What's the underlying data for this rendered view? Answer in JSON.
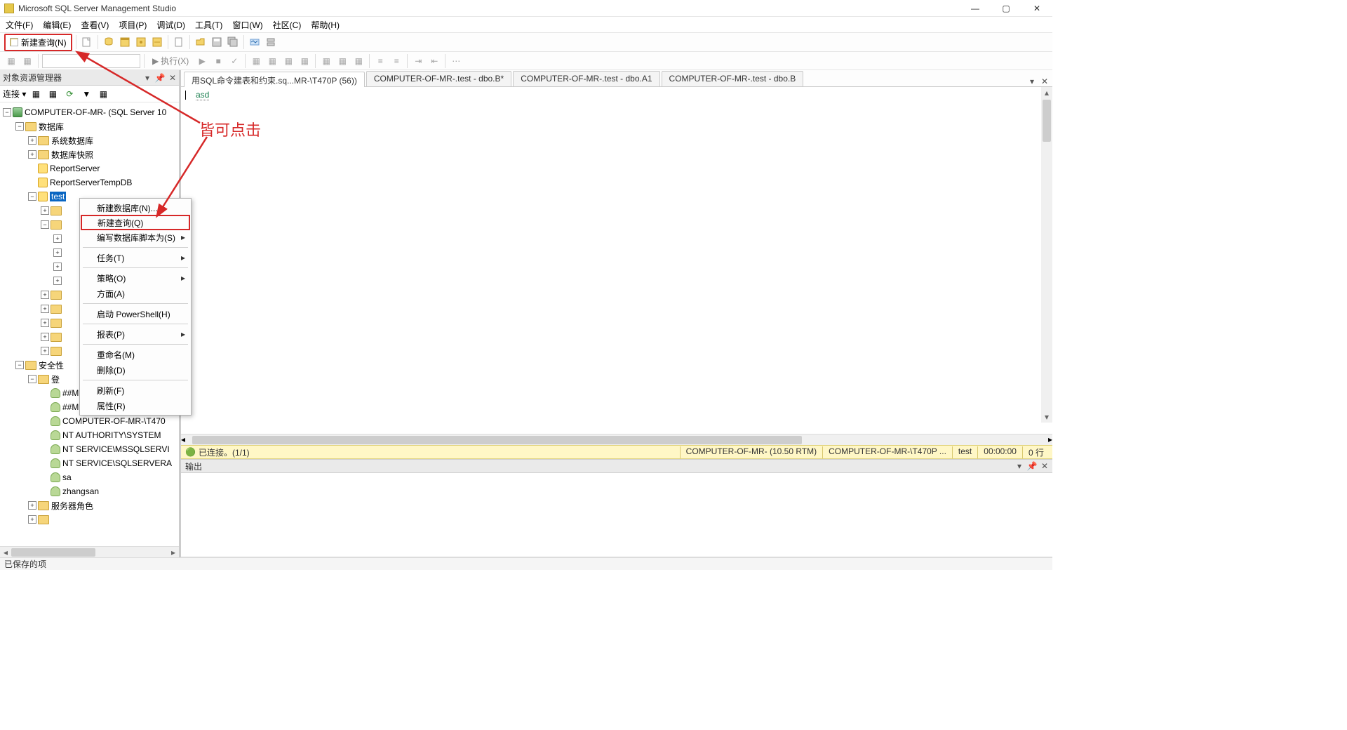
{
  "window": {
    "title": "Microsoft SQL Server Management Studio"
  },
  "menu": {
    "file": "文件(F)",
    "edit": "编辑(E)",
    "view": "查看(V)",
    "project": "项目(P)",
    "debug": "调试(D)",
    "tools": "工具(T)",
    "window": "窗口(W)",
    "community": "社区(C)",
    "help": "帮助(H)"
  },
  "toolbar": {
    "new_query": "新建查询(N)",
    "execute": "执行(X)"
  },
  "object_explorer": {
    "title": "对象资源管理器",
    "connect_label": "连接 ▾",
    "server": "COMPUTER-OF-MR- (SQL Server 10",
    "db_root": "数据库",
    "sys_db": "系统数据库",
    "db_snapshot": "数据库快照",
    "report_server": "ReportServer",
    "report_server_temp": "ReportServerTempDB",
    "sel_db": "test",
    "security": "安全性",
    "logins": "登",
    "logins_items": [
      "##MS_PolicyEventProcess",
      "##MS_PolicyTsqlExecution",
      "COMPUTER-OF-MR-\\T470",
      "NT AUTHORITY\\SYSTEM",
      "NT SERVICE\\MSSQLSERVI",
      "NT SERVICE\\SQLSERVERA",
      "sa",
      "zhangsan"
    ],
    "server_roles": "服务器角色"
  },
  "context_menu": {
    "new_db": "新建数据库(N)...",
    "new_query": "新建查询(Q)",
    "script": "编写数据库脚本为(S)",
    "tasks": "任务(T)",
    "policies": "策略(O)",
    "facets": "方面(A)",
    "powershell": "启动 PowerShell(H)",
    "reports": "报表(P)",
    "rename": "重命名(M)",
    "delete": "删除(D)",
    "refresh": "刷新(F)",
    "properties": "属性(R)"
  },
  "tabs": [
    "用SQL命令建表和约束.sq...MR-\\T470P (56))",
    "COMPUTER-OF-MR-.test - dbo.B*",
    "COMPUTER-OF-MR-.test - dbo.A1",
    "COMPUTER-OF-MR-.test - dbo.B"
  ],
  "editor": {
    "content": "asd"
  },
  "query_status": {
    "connected": "已连接。(1/1)",
    "server": "COMPUTER-OF-MR- (10.50 RTM)",
    "user": "COMPUTER-OF-MR-\\T470P ...",
    "db": "test",
    "time": "00:00:00",
    "rows": "0 行"
  },
  "output": {
    "title": "输出"
  },
  "status": {
    "saved": "已保存的项"
  },
  "annotation": {
    "text": "皆可点击"
  }
}
